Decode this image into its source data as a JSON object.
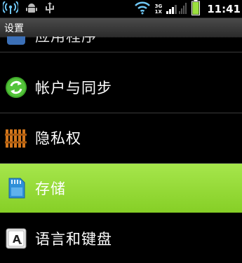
{
  "status_bar": {
    "time": "11:41",
    "network_top": "3G",
    "network_bottom": "1X",
    "icons": [
      "wifi-tethering-icon",
      "android-debug-icon",
      "usb-icon",
      "wifi-icon",
      "signal-icon",
      "battery-icon"
    ]
  },
  "title_bar": {
    "title": "设置"
  },
  "settings_list": {
    "items": [
      {
        "label": "应用程序",
        "icon": "apps-icon"
      },
      {
        "label": "帐户与同步",
        "icon": "sync-icon"
      },
      {
        "label": "隐私权",
        "icon": "privacy-fence-icon"
      },
      {
        "label": "存储",
        "icon": "sd-card-icon",
        "selected": true
      },
      {
        "label": "语言和键盘",
        "icon": "keyboard-icon"
      }
    ]
  },
  "colors": {
    "selected_bg": "#9be03e",
    "sync_green": "#3fa82a",
    "privacy_orange": "#d2761c",
    "sd_blue": "#2e8fd8"
  }
}
